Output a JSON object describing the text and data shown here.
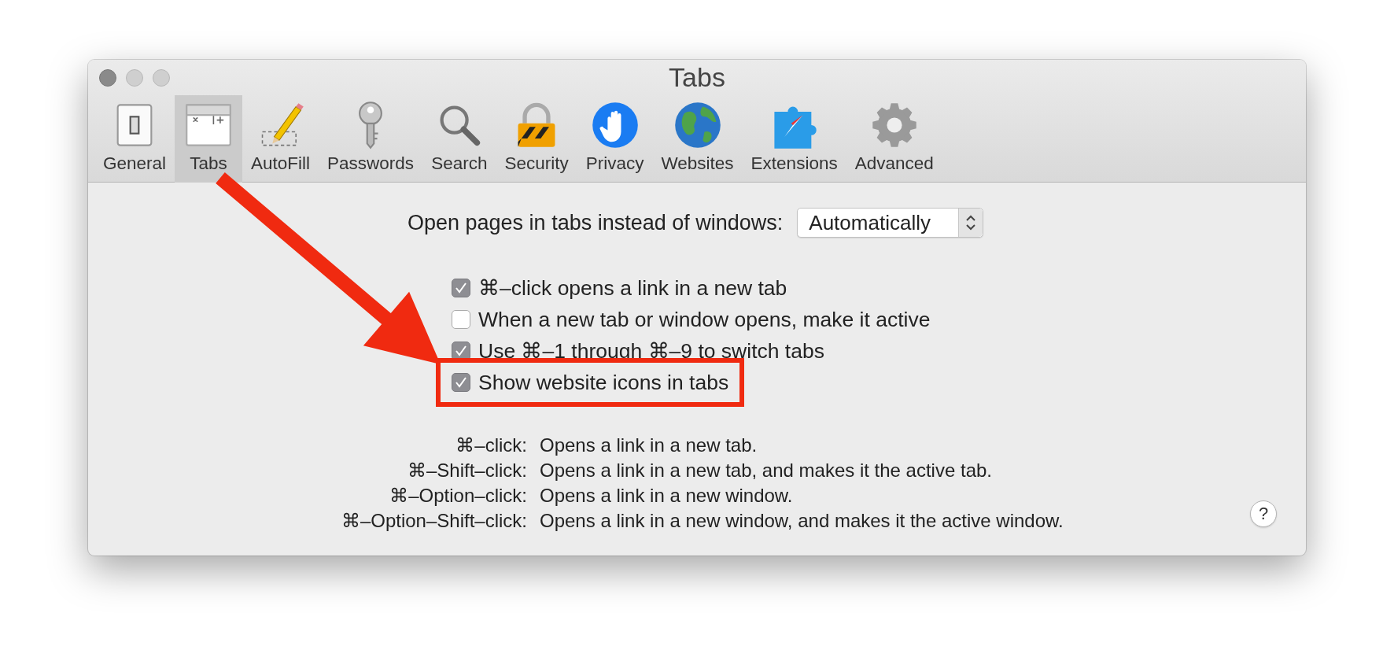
{
  "window": {
    "title": "Tabs"
  },
  "tabs": [
    {
      "label": "General",
      "kind": "general",
      "selected": false
    },
    {
      "label": "Tabs",
      "kind": "tabs",
      "selected": true
    },
    {
      "label": "AutoFill",
      "kind": "autofill",
      "selected": false
    },
    {
      "label": "Passwords",
      "kind": "passwords",
      "selected": false
    },
    {
      "label": "Search",
      "kind": "search",
      "selected": false
    },
    {
      "label": "Security",
      "kind": "security",
      "selected": false
    },
    {
      "label": "Privacy",
      "kind": "privacy",
      "selected": false
    },
    {
      "label": "Websites",
      "kind": "websites",
      "selected": false
    },
    {
      "label": "Extensions",
      "kind": "extensions",
      "selected": false
    },
    {
      "label": "Advanced",
      "kind": "advanced",
      "selected": false
    }
  ],
  "open_pages": {
    "label": "Open pages in tabs instead of windows:",
    "value": "Automatically"
  },
  "options": [
    {
      "label": "⌘–click opens a link in a new tab",
      "checked": true,
      "highlighted": false
    },
    {
      "label": "When a new tab or window opens, make it active",
      "checked": false,
      "highlighted": false
    },
    {
      "label": "Use ⌘–1 through ⌘–9 to switch tabs",
      "checked": true,
      "highlighted": false
    },
    {
      "label": "Show website icons in tabs",
      "checked": true,
      "highlighted": true
    }
  ],
  "shortcuts": [
    {
      "keys": "⌘–click:",
      "description": "Opens a link in a new tab."
    },
    {
      "keys": "⌘–Shift–click:",
      "description": "Opens a link in a new tab, and makes it the active tab."
    },
    {
      "keys": "⌘–Option–click:",
      "description": "Opens a link in a new window."
    },
    {
      "keys": "⌘–Option–Shift–click:",
      "description": "Opens a link in a new window, and makes it the active window."
    }
  ],
  "help_button": "?"
}
